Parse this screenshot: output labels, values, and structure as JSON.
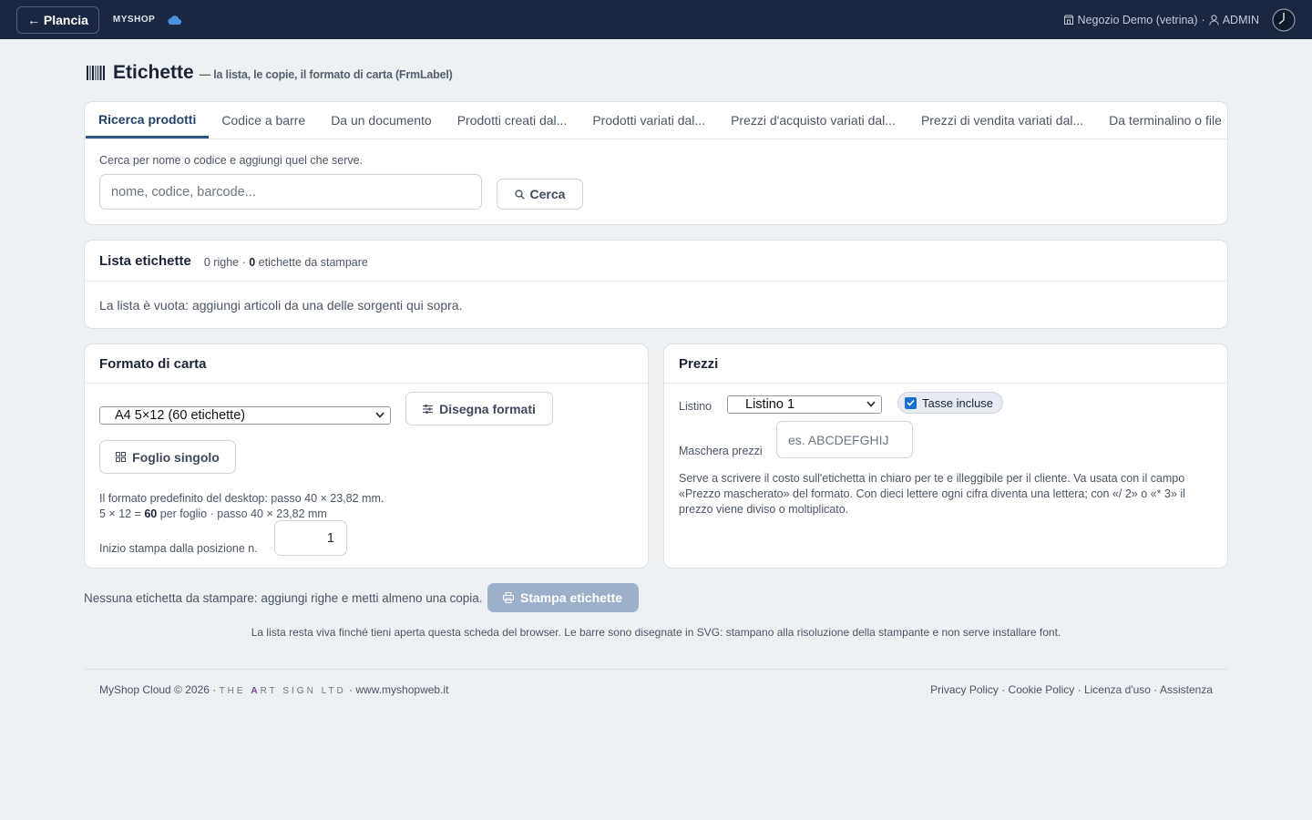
{
  "topbar": {
    "back_label": "← Plancia",
    "brand": "MYSHOP",
    "store": "Negozio Demo (vetrina)",
    "separator": "·",
    "user": "ADMIN"
  },
  "page": {
    "title": "Etichette",
    "subtitle": "— la lista, le copie, il formato di carta (FrmLabel)"
  },
  "search": {
    "tabs": [
      {
        "label": "Ricerca prodotti",
        "active": true
      },
      {
        "label": "Codice a barre"
      },
      {
        "label": "Da un documento"
      },
      {
        "label": "Prodotti creati dal..."
      },
      {
        "label": "Prodotti variati dal..."
      },
      {
        "label": "Prezzi d'acquisto variati dal..."
      },
      {
        "label": "Prezzi di vendita variati dal..."
      },
      {
        "label": "Da terminalino o file"
      }
    ],
    "hint": "Cerca per nome o codice e aggiungi quel che serve.",
    "placeholder": "nome, codice, barcode...",
    "button_label": "Cerca"
  },
  "list": {
    "title": "Lista etichette",
    "rows": "0 righe",
    "count_sep": " · ",
    "labels_count": "0",
    "labels_suffix": " etichette da stampare",
    "empty_message": "La lista è vuota: aggiungi articoli da una delle sorgenti qui sopra."
  },
  "paper": {
    "title": "Formato di carta",
    "selected_format": "A4 5×12 (60 etichette)",
    "draw_button": "Disegna formati",
    "single_button": "Foglio singolo",
    "desc_line1": "Il formato predefinito del desktop: passo 40 × 23,82 mm.",
    "desc_line2_prefix": "5 × 12 = ",
    "desc_line2_bold": "60",
    "desc_line2_suffix": " per foglio · passo 40 × 23,82 mm",
    "start_label": "Inizio stampa dalla posizione n.",
    "start_value": "1"
  },
  "prices": {
    "title": "Prezzi",
    "listino_label": "Listino",
    "listino_value": "Listino 1",
    "tax_label": "Tasse incluse",
    "tax_checked": true,
    "mask_label": "Maschera prezzi",
    "mask_placeholder": "es. ABCDEFGHIJ",
    "description": "Serve a scrivere il costo sull'etichetta in chiaro per te e illeggibile per il cliente. Va usata con il campo «Prezzo mascherato» del formato. Con dieci lettere ogni cifra diventa una lettera; con «/ 2» o «* 3» il prezzo viene diviso o moltiplicato."
  },
  "print": {
    "message": "Nessuna etichetta da stampare: aggiungi righe e metti almeno una copia.",
    "button_label": "Stampa etichette"
  },
  "note": "La lista resta viva finché tieni aperta questa scheda del browser. Le barre sono disegnate in SVG: stampano alla risoluzione della stampante e non serve installare font.",
  "footer": {
    "copyright": "MyShop Cloud © 2026 · ",
    "company_pre": "THE ",
    "company_a": "A",
    "company_post": "RT SIGN LTD",
    "site": " · www.myshopweb.it",
    "links": [
      "Privacy Policy",
      "Cookie Policy",
      "Licenza d'uso",
      "Assistenza"
    ]
  },
  "colors": {
    "topbar": "#1b2740",
    "accent": "#2c5585",
    "print_disabled": "#9db0ca"
  }
}
